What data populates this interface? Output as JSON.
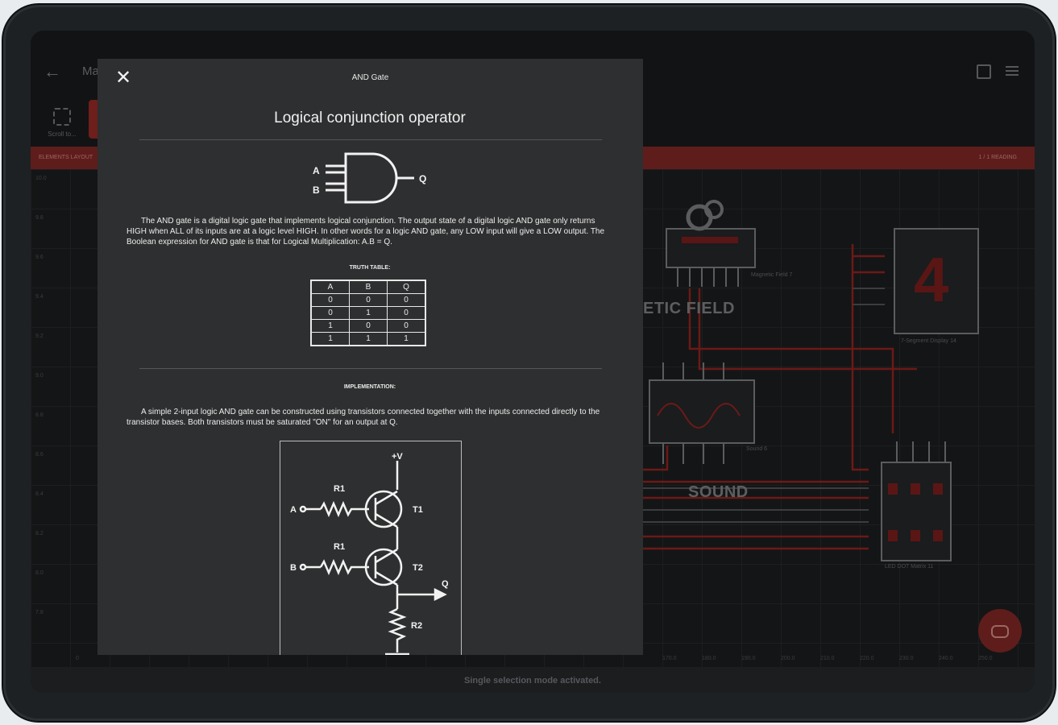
{
  "app": {
    "title": "Ma",
    "tool_label": "Scroll to..."
  },
  "status_bar": {
    "left": "ELEMENTS LAYOUT",
    "right": "1 / 1 READING"
  },
  "axis": {
    "y_ticks": [
      "10.0",
      "9.8",
      "9.6",
      "9.4",
      "9.2",
      "9.0",
      "8.8",
      "8.6",
      "8.4",
      "8.2",
      "8.0",
      "7.8"
    ],
    "x_ticks": [
      "0",
      "170.0",
      "180.0",
      "190.0",
      "200.0",
      "210.0",
      "220.0",
      "230.0",
      "240.0",
      "250.0"
    ]
  },
  "circuit": {
    "labels": {
      "magnetic_field_big": "ETIC   FIELD",
      "sound_big": "SOUND",
      "magnetic_field": "Magnetic Field 7",
      "seven_seg": "7-Segment Display 14",
      "sound": "Sound 6",
      "led_matrix": "LED DOT Matrix 11",
      "seven_seg_digit": "4"
    }
  },
  "bottom_bar": {
    "message": "Single selection mode activated."
  },
  "modal": {
    "close_icon": "close-icon",
    "title": "AND Gate",
    "heading": "Logical conjunction operator",
    "gate_inputs": [
      "A",
      "B"
    ],
    "gate_output": "Q",
    "description": "The AND gate is a digital logic gate that implements logical conjunction. The output state of a digital logic AND gate only returns HIGH when ALL of its inputs are at a logic level HIGH. In other words for a logic AND gate, any LOW input will give a LOW output. The Boolean expression for AND gate is that for Logical Multiplication: A.B = Q.",
    "truth_table_heading": "TRUTH TABLE:",
    "truth_table": {
      "headers": [
        "A",
        "B",
        "Q"
      ],
      "rows": [
        [
          "0",
          "0",
          "0"
        ],
        [
          "0",
          "1",
          "0"
        ],
        [
          "1",
          "0",
          "0"
        ],
        [
          "1",
          "1",
          "1"
        ]
      ]
    },
    "implementation_heading": "IMPLEMENTATION:",
    "implementation_text": "A simple 2-input logic AND gate can be constructed using transistors connected together with the inputs connected directly to the transistor bases. Both transistors must be saturated \"ON\" for an output at Q.",
    "schematic": {
      "vcc": "+V",
      "r1_top": "R1",
      "r1_bottom": "R1",
      "r2": "R2",
      "t1": "T1",
      "t2": "T2",
      "in_a": "A",
      "in_b": "B",
      "out_q": "Q"
    }
  },
  "colors": {
    "accent_red": "#b3231f",
    "modal_bg": "#2e2f30"
  }
}
